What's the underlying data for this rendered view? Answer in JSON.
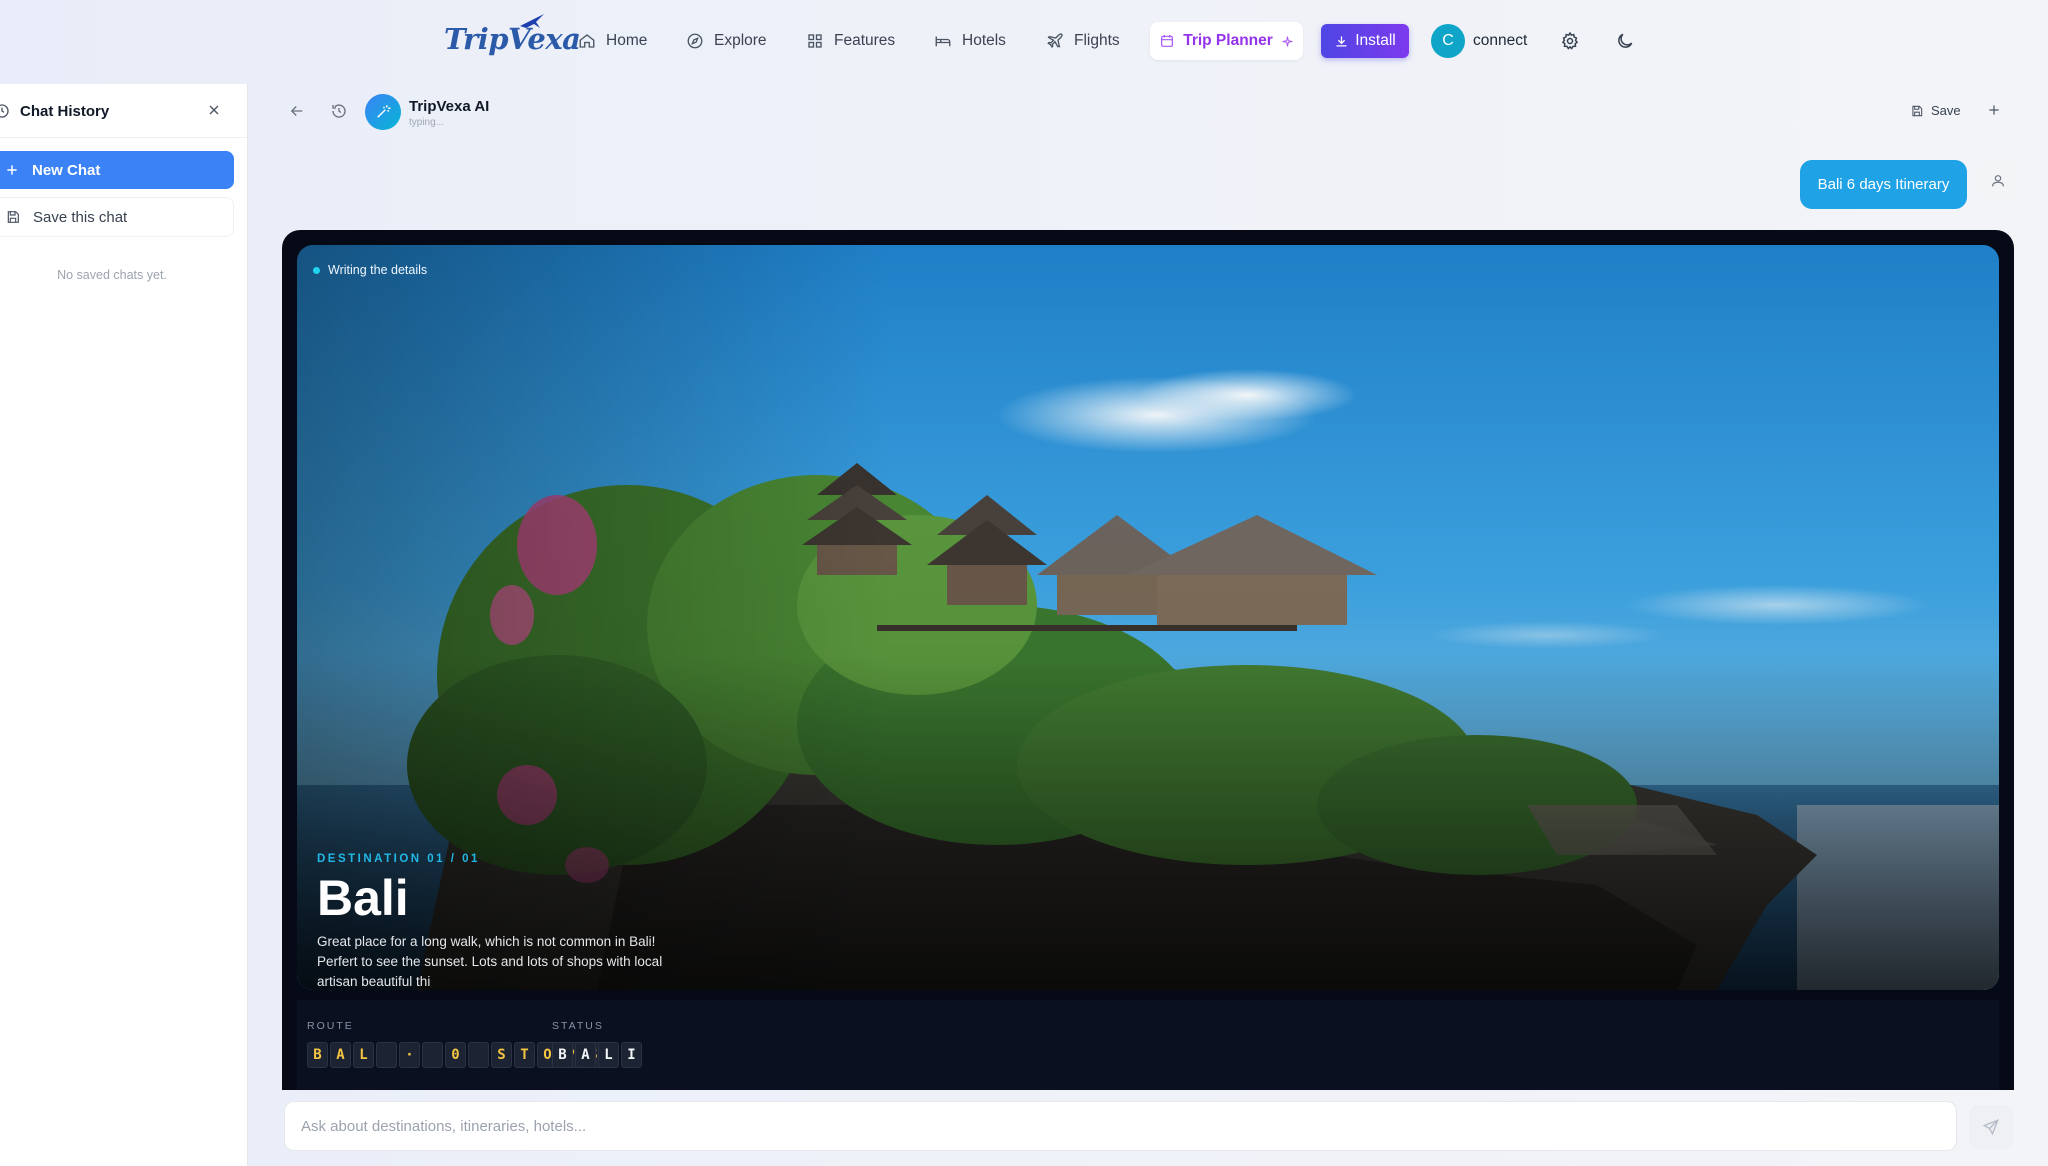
{
  "brand": {
    "logo_text": "TripVexa"
  },
  "nav": {
    "items": [
      {
        "label": "Home",
        "icon": "home-icon"
      },
      {
        "label": "Explore",
        "icon": "compass-icon"
      },
      {
        "label": "Features",
        "icon": "grid-icon"
      },
      {
        "label": "Hotels",
        "icon": "bed-icon"
      },
      {
        "label": "Flights",
        "icon": "plane-icon"
      }
    ],
    "trip_planner": "Trip Planner",
    "install": "Install",
    "user_initial": "C",
    "user_label": "connect"
  },
  "sidebar": {
    "title": "Chat History",
    "new_chat": "New Chat",
    "save_chat": "Save this chat",
    "empty_text": "No saved chats yet."
  },
  "chat": {
    "assistant_name": "TripVexa AI",
    "assistant_status": "typing...",
    "save_label": "Save",
    "user_message": "Bali 6 days Itinerary"
  },
  "card": {
    "status_text": "Writing the details",
    "eyebrow": "DESTINATION 01 / 01",
    "destination": "Bali",
    "description": "Great place for a long walk, which is not common in Bali! Perfert to see the sunset. Lots and lots of shops with local artisan beautiful thi",
    "route_label": "ROUTE",
    "route_tiles": [
      "B",
      "A",
      "L",
      "",
      "·",
      "",
      "0",
      "",
      "S",
      "T",
      "O",
      "P",
      "S"
    ],
    "status_label": "STATUS",
    "status_tiles": [
      "B",
      "A",
      "L",
      "I"
    ]
  },
  "composer": {
    "placeholder": "Ask about destinations, itineraries, hotels..."
  },
  "colors": {
    "accent_blue": "#3b82f6",
    "bubble_blue": "#1fa2e6",
    "planner_purple": "#9333ea",
    "install_gradient_start": "#4f46e5",
    "tile_text": "#f5c542"
  }
}
